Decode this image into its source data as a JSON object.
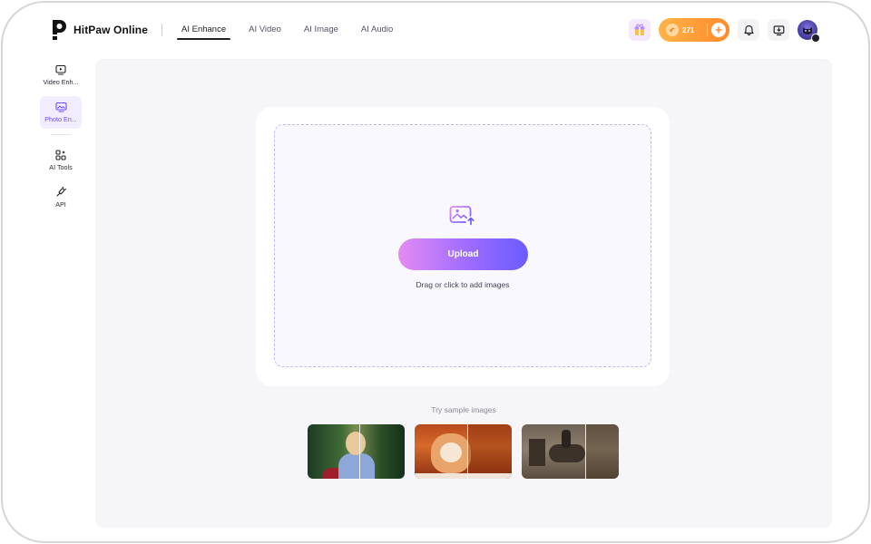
{
  "brand": {
    "name": "HitPaw Online"
  },
  "nav": {
    "items": [
      {
        "label": "AI Enhance",
        "active": true
      },
      {
        "label": "AI Video",
        "active": false
      },
      {
        "label": "AI Image",
        "active": false
      },
      {
        "label": "AI Audio",
        "active": false
      }
    ]
  },
  "header": {
    "credits": "271",
    "icons": [
      "gift-icon",
      "coin-icon",
      "plus-icon",
      "bell-icon",
      "monitor-download-icon",
      "avatar"
    ]
  },
  "sidebar": {
    "items": [
      {
        "label": "Video Enh...",
        "icon": "video-enhance-icon",
        "active": false
      },
      {
        "label": "Photo En...",
        "icon": "photo-enhance-icon",
        "active": true
      },
      {
        "label": "AI Tools",
        "icon": "ai-tools-icon",
        "active": false
      },
      {
        "label": "API",
        "icon": "api-icon",
        "active": false
      }
    ]
  },
  "upload": {
    "button_label": "Upload",
    "hint": "Drag or click to add images"
  },
  "samples": {
    "title": "Try sample images"
  },
  "colors": {
    "accent": "#6a4dff",
    "upload_gradient_start": "#e48bf3",
    "upload_gradient_end": "#6b5bff",
    "credit_pill": "#ff8a2a"
  }
}
